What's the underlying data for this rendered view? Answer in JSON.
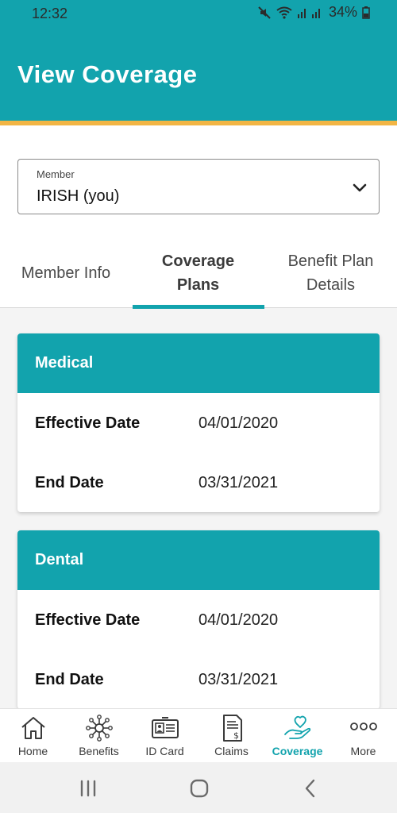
{
  "status_bar": {
    "time": "12:32",
    "battery": "34%"
  },
  "header": {
    "title": "View Coverage"
  },
  "member": {
    "label": "Member",
    "value": "IRISH (you)"
  },
  "tabs": [
    {
      "label": "Member Info"
    },
    {
      "label": "Coverage Plans"
    },
    {
      "label": "Benefit Plan Details"
    }
  ],
  "plans": [
    {
      "name": "Medical",
      "effective_label": "Effective Date",
      "effective": "04/01/2020",
      "end_label": "End Date",
      "end": "03/31/2021"
    },
    {
      "name": "Dental",
      "effective_label": "Effective Date",
      "effective": "04/01/2020",
      "end_label": "End Date",
      "end": "03/31/2021"
    }
  ],
  "bottom_nav": [
    {
      "label": "Home",
      "icon": "home-icon"
    },
    {
      "label": "Benefits",
      "icon": "benefits-icon"
    },
    {
      "label": "ID Card",
      "icon": "id-card-icon"
    },
    {
      "label": "Claims",
      "icon": "claims-icon"
    },
    {
      "label": "Coverage",
      "icon": "coverage-icon",
      "active": true
    },
    {
      "label": "More",
      "icon": "more-icon"
    }
  ],
  "colors": {
    "brand": "#12a3ad",
    "accent_stripe": "#f2b544"
  }
}
